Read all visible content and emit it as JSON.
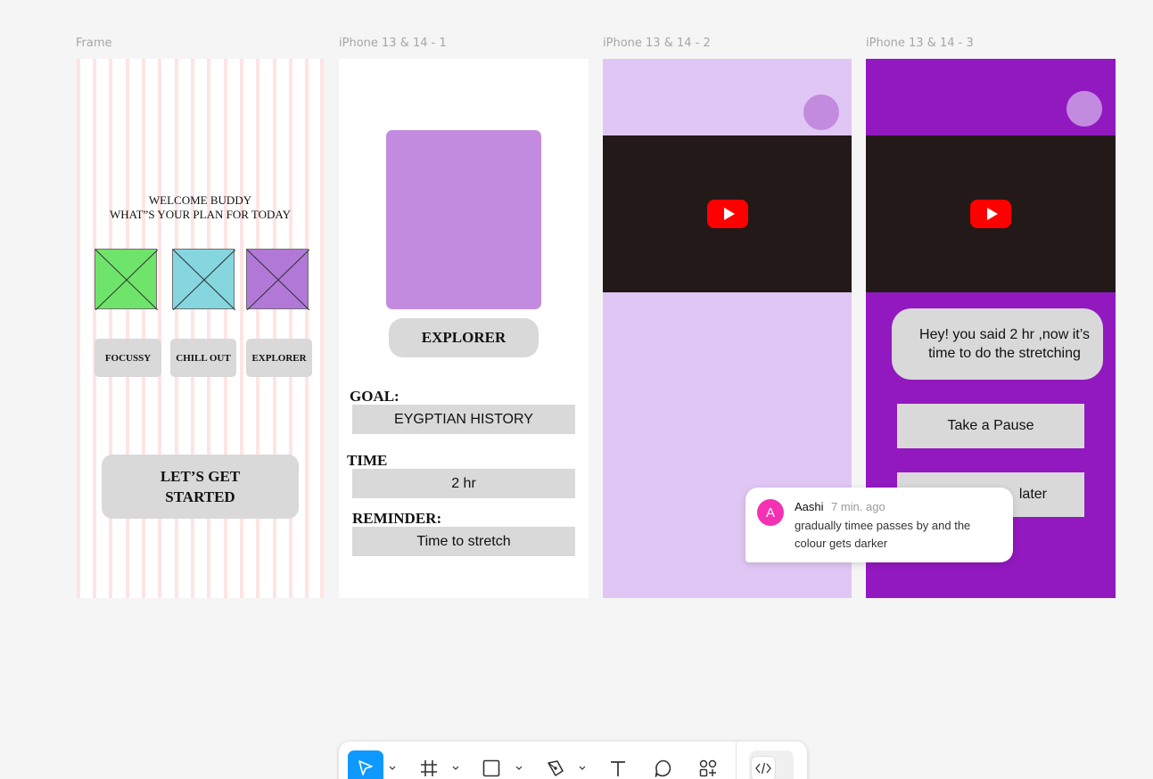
{
  "frames": [
    {
      "label": "Frame"
    },
    {
      "label": "iPhone 13 & 14 - 1"
    },
    {
      "label": "iPhone 13 & 14 - 2"
    },
    {
      "label": "iPhone 13 & 14 - 3"
    }
  ],
  "welcome": {
    "line1": "WELCOME  BUDDY",
    "line2": "WHAT”S YOUR PLAN FOR TODAY"
  },
  "placeholders": [
    {
      "color": "#6fe46a"
    },
    {
      "color": "#85d6df"
    },
    {
      "color": "#b178d8"
    }
  ],
  "options": [
    "FOCUSSY",
    "CHILL OUT",
    "EXPLORER"
  ],
  "start": {
    "line1": "LET’S GET",
    "line2": "STARTED"
  },
  "plan": {
    "mode": "EXPLORER",
    "goal_label": "GOAL:",
    "goal_value": "EYGPTIAN HISTORY",
    "time_label": "TIME",
    "time_value": "2 hr",
    "reminder_label": "REMINDER:",
    "reminder_value": "Time to  stretch"
  },
  "prompt": {
    "message": "Hey! you said 2 hr ,now it’s time to do the stretching",
    "pause_label": "Take a  Pause",
    "later_label": "later"
  },
  "comment": {
    "avatar": "A",
    "author": "Aashi",
    "time": "7 min. ago",
    "text": "gradually timee passes by and the colour gets darker"
  },
  "colors": {
    "accent": "#0d99ff",
    "frame2_bg": "#e0c6f4",
    "frame3_bg": "#9219bf",
    "purple_card": "#c38be0",
    "youtube_red": "#ff0000",
    "avatar_pink": "#f531b3"
  },
  "toolbar": {
    "tools": [
      "move-tool",
      "frame-tool",
      "shape-tool",
      "pen-tool",
      "text-tool",
      "comment-tool",
      "actions-tool",
      "dev-mode-toggle"
    ],
    "selected": "move-tool"
  }
}
